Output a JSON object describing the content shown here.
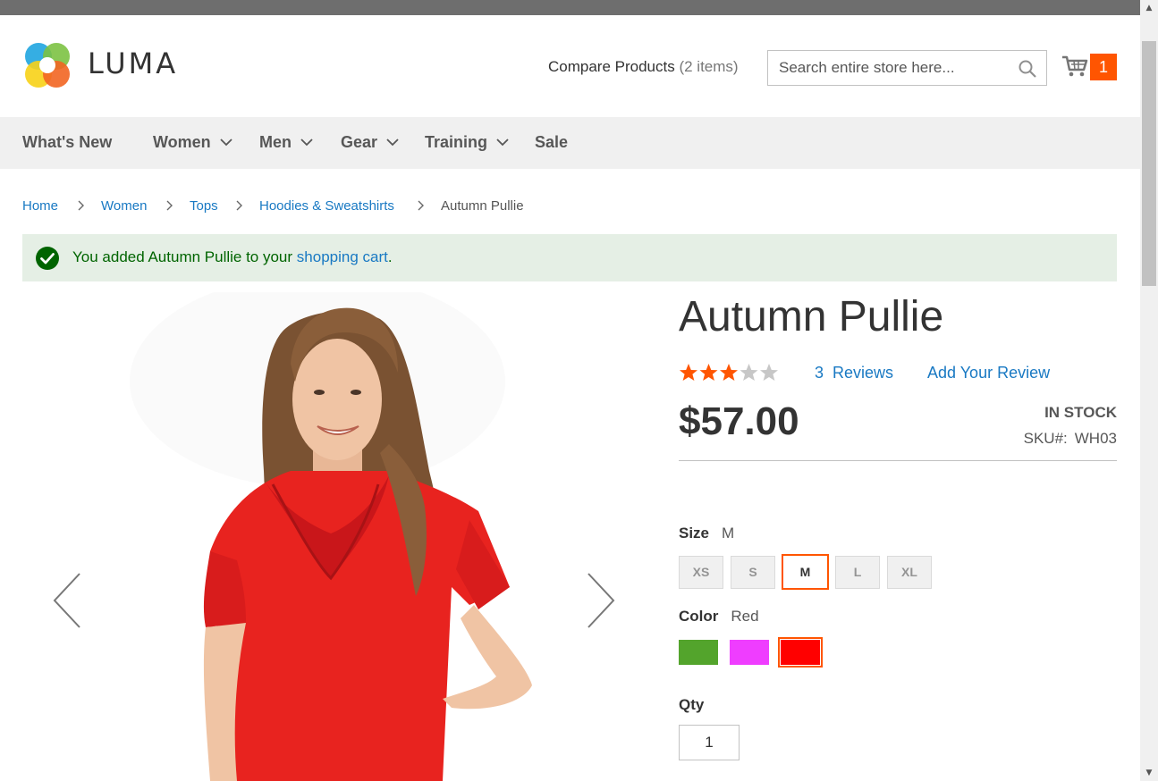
{
  "brand": {
    "name": "LUMA",
    "accent": "#ff5501",
    "link": "#1979c3"
  },
  "header": {
    "compare_label": "Compare Products",
    "compare_count": "(2 items)",
    "search_placeholder": "Search entire store here...",
    "cart_count": "1"
  },
  "nav": [
    {
      "label": "What's New",
      "has_dropdown": false
    },
    {
      "label": "Women",
      "has_dropdown": true
    },
    {
      "label": "Men",
      "has_dropdown": true
    },
    {
      "label": "Gear",
      "has_dropdown": true
    },
    {
      "label": "Training",
      "has_dropdown": true
    },
    {
      "label": "Sale",
      "has_dropdown": false
    }
  ],
  "breadcrumb": [
    "Home",
    "Women",
    "Tops",
    "Hoodies & Sweatshirts",
    "Autumn Pullie"
  ],
  "message": {
    "prefix": "You added Autumn Pullie to your ",
    "link": "shopping cart",
    "suffix": "."
  },
  "product": {
    "title": "Autumn Pullie",
    "rating_stars": 3,
    "rating_max": 5,
    "reviews_count": "3",
    "reviews_label": "Reviews",
    "add_review": "Add Your Review",
    "price": "$57.00",
    "stock": "In stock",
    "sku_label": "SKU#:",
    "sku": "WH03"
  },
  "options": {
    "size_label": "Size",
    "size_selected": "M",
    "sizes": [
      "XS",
      "S",
      "M",
      "L",
      "XL"
    ],
    "color_label": "Color",
    "color_selected": "Red",
    "colors": [
      {
        "name": "Green",
        "hex": "#53a42c"
      },
      {
        "name": "Purple",
        "hex": "#ef3dff"
      },
      {
        "name": "Red",
        "hex": "#ff0000"
      }
    ],
    "qty_label": "Qty",
    "qty_value": "1"
  }
}
